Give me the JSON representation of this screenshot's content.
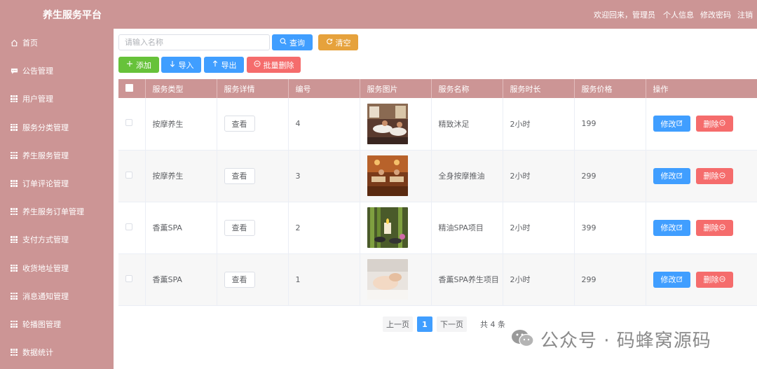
{
  "header": {
    "title": "养生服务平台",
    "welcome": "欢迎回来，管理员",
    "profile": "个人信息",
    "change_password": "修改密码",
    "logout": "注销"
  },
  "sidebar": {
    "items": [
      {
        "label": "首页",
        "icon": "home-icon"
      },
      {
        "label": "公告管理",
        "icon": "chat-icon"
      },
      {
        "label": "用户管理",
        "icon": "grid-icon"
      },
      {
        "label": "服务分类管理",
        "icon": "grid-icon"
      },
      {
        "label": "养生服务管理",
        "icon": "grid-icon"
      },
      {
        "label": "订单评论管理",
        "icon": "grid-icon"
      },
      {
        "label": "养生服务订单管理",
        "icon": "grid-icon"
      },
      {
        "label": "支付方式管理",
        "icon": "grid-icon"
      },
      {
        "label": "收货地址管理",
        "icon": "grid-icon"
      },
      {
        "label": "消息通知管理",
        "icon": "grid-icon"
      },
      {
        "label": "轮播图管理",
        "icon": "grid-icon"
      },
      {
        "label": "数据统计",
        "icon": "grid-icon"
      }
    ]
  },
  "search": {
    "placeholder": "请输入名称",
    "query_label": "查询",
    "clear_label": "清空"
  },
  "toolbar": {
    "add_label": "添加",
    "import_label": "导入",
    "export_label": "导出",
    "batch_delete_label": "批量删除"
  },
  "table": {
    "columns": [
      "服务类型",
      "服务详情",
      "编号",
      "服务图片",
      "服务名称",
      "服务时长",
      "服务价格",
      "操作"
    ],
    "rows": [
      {
        "type": "按摩养生",
        "detail": "查看",
        "id": "4",
        "name": "精致沐足",
        "duration": "2小时",
        "price": "199"
      },
      {
        "type": "按摩养生",
        "detail": "查看",
        "id": "3",
        "name": "全身按摩推油",
        "duration": "2小时",
        "price": "299"
      },
      {
        "type": "香薰SPA",
        "detail": "查看",
        "id": "2",
        "name": "精油SPA项目",
        "duration": "2小时",
        "price": "399"
      },
      {
        "type": "香薰SPA",
        "detail": "查看",
        "id": "1",
        "name": "香薰SPA养生项目",
        "duration": "2小时",
        "price": "299"
      }
    ],
    "edit_label": "修改",
    "delete_label": "删除"
  },
  "pagination": {
    "prev": "上一页",
    "current": "1",
    "next": "下一页",
    "total": "共 4 条"
  },
  "watermark": {
    "text": "公众号 · 码蜂窝源码"
  },
  "colors": {
    "theme": "#cc9595",
    "primary": "#409eff",
    "success": "#67c23a",
    "warning": "#e6a23c",
    "danger": "#f56c6c"
  }
}
